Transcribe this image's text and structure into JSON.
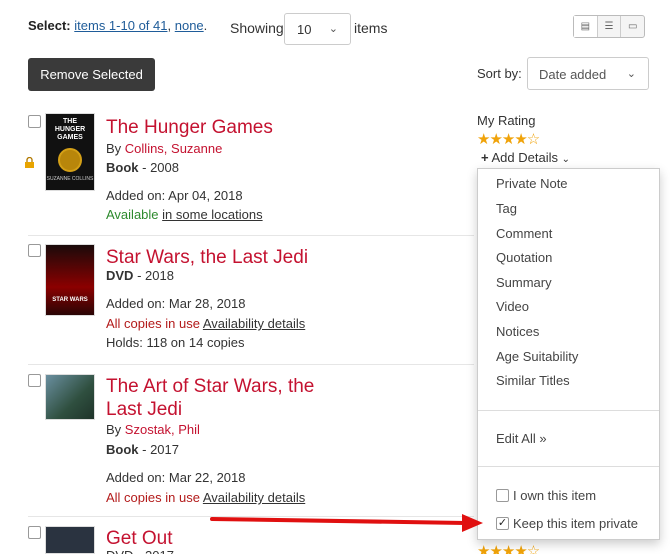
{
  "toolbar": {
    "select_label": "Select:",
    "select_range": "items 1-10 of 41",
    "select_sep": ",",
    "select_none": "none",
    "select_end": ".",
    "showing_label": "Showing",
    "per_page": "10",
    "items_label": "items",
    "remove_selected": "Remove Selected",
    "sort_label": "Sort by:",
    "sort_value": "Date added"
  },
  "items": [
    {
      "title": "The Hunger Games",
      "by_label": "By",
      "author": "Collins, Suzanne",
      "format": "Book",
      "year": "- 2008",
      "added": "Added on: Apr 04, 2018",
      "status": "Available",
      "status_link": "in some locations",
      "cover_text": "THE HUNGER GAMES",
      "cover_sub": "SUZANNE COLLINS"
    },
    {
      "title": "Star Wars, the Last Jedi",
      "format": "DVD",
      "year": "- 2018",
      "added": "Added on: Mar 28, 2018",
      "status": "All copies in use",
      "status_link": "Availability details",
      "holds": "Holds: 118 on 14 copies",
      "cover_text": "STAR WARS"
    },
    {
      "title_line1": "The Art of Star Wars, the",
      "title_line2": "Last Jedi",
      "by_label": "By",
      "author": "Szostak, Phil",
      "format": "Book",
      "year": "- 2017",
      "added": "Added on: Mar 22, 2018",
      "status": "All copies in use",
      "status_link": "Availability details"
    },
    {
      "title": "Get Out",
      "format_partial": "DVD - 2017"
    }
  ],
  "rating": {
    "label": "My Rating",
    "stars": "★★★★☆",
    "value": 3.5,
    "add_details": "Add Details"
  },
  "dropdown": {
    "items": [
      "Private Note",
      "Tag",
      "Comment",
      "Quotation",
      "Summary",
      "Video",
      "Notices",
      "Age Suitability",
      "Similar Titles"
    ],
    "edit_all": "Edit All »",
    "own_item": "I own this item",
    "keep_private": "Keep this item private"
  },
  "colors": {
    "title": "#c41230",
    "link": "#1f5c99",
    "available": "#2d8a2d",
    "in_use": "#b31b1b",
    "arrow": "#e01010",
    "star": "#f0a30a"
  }
}
